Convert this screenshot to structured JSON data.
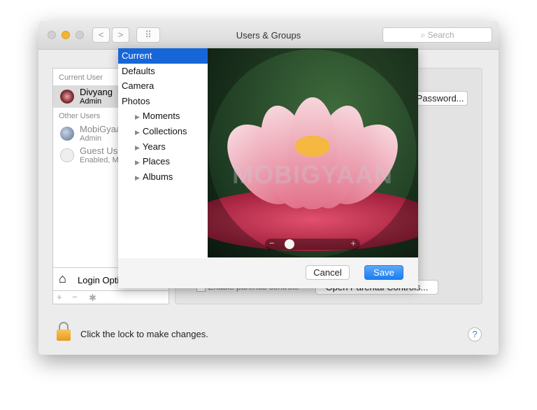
{
  "window": {
    "title": "Users & Groups",
    "search_placeholder": "Search",
    "nav_back": "<",
    "nav_forward": ">",
    "grid": "⠿"
  },
  "sidebar": {
    "current_user_header": "Current User",
    "current_user": {
      "name": "Divyang",
      "role": "Admin"
    },
    "other_users_header": "Other Users",
    "others": [
      {
        "name": "MobiGyaan",
        "role": "Admin"
      },
      {
        "name": "Guest User",
        "role": "Enabled, Managed"
      }
    ],
    "login_options": "Login Options",
    "add": "+",
    "remove": "−",
    "gear": "✱"
  },
  "main": {
    "change_password": "Change Password...",
    "parental_checkbox": "Enable parental controls",
    "open_parental": "Open Parental Controls..."
  },
  "picker": {
    "sources": [
      "Current",
      "Defaults",
      "Camera",
      "Photos"
    ],
    "photo_items": [
      "Moments",
      "Collections",
      "Years",
      "Places",
      "Albums"
    ],
    "selected": "Current",
    "zoom_slider": {
      "value": 0.12,
      "minus": "−",
      "plus": "+"
    },
    "cancel": "Cancel",
    "save": "Save",
    "watermark": "MOBIGYAAN"
  },
  "footer": {
    "lock_text": "Click the lock to make changes.",
    "help": "?"
  },
  "colors": {
    "accent": "#1666d8",
    "minimize": "#f5b431",
    "save": "#2a8cf5"
  }
}
